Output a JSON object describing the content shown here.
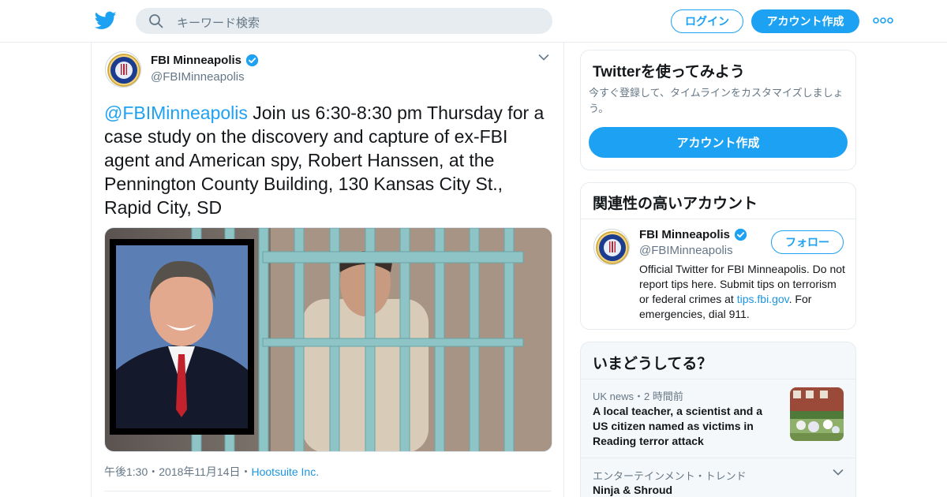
{
  "header": {
    "logo_icon": "twitter-bird-icon",
    "search_placeholder": "キーワード検索",
    "login_label": "ログイン",
    "signup_label": "アカウント作成",
    "more_icon": "more-dots-icon"
  },
  "tweet": {
    "author_name": "FBI Minneapolis",
    "author_handle": "@FBIMinneapolis",
    "mention": "@FBIMinneapolis",
    "text": " Join us 6:30-8:30 pm Thursday for a case study on the discovery and capture of ex-FBI agent and American spy, Robert Hanssen, at the Pennington County Building, 130 Kansas City St., Rapid City, SD",
    "time": "午後1:30",
    "date": "2018年11月14日",
    "source": "Hootsuite Inc.",
    "sep": "・"
  },
  "sidebar": {
    "signup_card": {
      "title": "Twitterを使ってみよう",
      "description": "今すぐ登録して、タイムラインをカスタマイズしましょう。",
      "button_label": "アカウント作成"
    },
    "related_card": {
      "title": "関連性の高いアカウント",
      "name": "FBI Minneapolis",
      "handle": "@FBIMinneapolis",
      "follow_label": "フォロー",
      "bio_before": "Official Twitter for FBI Minneapolis. Do not report tips here. Submit tips on terrorism or federal crimes at ",
      "bio_link": "tips.fbi.gov",
      "bio_after": ". For emergencies, dial 911."
    },
    "trends_card": {
      "title": "いまどうしてる？",
      "news_source": "UK news",
      "news_time": "2 時間前",
      "news_sep": "・",
      "news_headline": "A local teacher, a scientist and a US citizen named as victims in Reading terror attack",
      "trend_category": "エンターテインメント・トレンド",
      "trend_name": "Ninja & Shroud"
    }
  },
  "colors": {
    "accent": "#1da1f2",
    "muted": "#657786",
    "border": "#e6ecf0"
  }
}
